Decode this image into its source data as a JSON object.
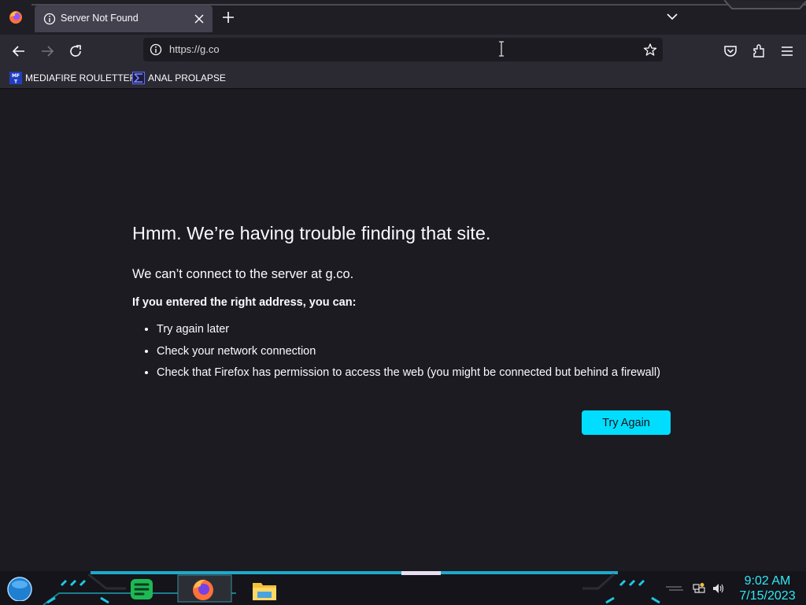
{
  "browser": {
    "tab": {
      "title": "Server Not Found"
    },
    "url": "https://g.co",
    "bookmarks": [
      {
        "label": "MEDIAFIRE ROULETTER",
        "icon": "mediafire-icon"
      },
      {
        "label": "ANAL PROLAPSE",
        "icon": "sigma-icon"
      }
    ]
  },
  "error_page": {
    "title": "Hmm. We’re having trouble finding that site.",
    "description": "We can’t connect to the server at g.co.",
    "hint": "If you entered the right address, you can:",
    "suggestions": [
      "Try again later",
      "Check your network connection",
      "Check that Firefox has permission to access the web (you might be connected but behind a firewall)"
    ],
    "button_label": "Try Again"
  },
  "taskbar": {
    "clock": {
      "time": "9:02 AM",
      "date": "7/15/2023"
    },
    "apps": [
      "spotify-icon",
      "firefox-icon",
      "file-explorer-icon"
    ]
  },
  "colors": {
    "accent": "#00ddff",
    "page_background": "#1c1b22",
    "toolbar": "#2b2a33",
    "clock": "#2ee8f5"
  }
}
